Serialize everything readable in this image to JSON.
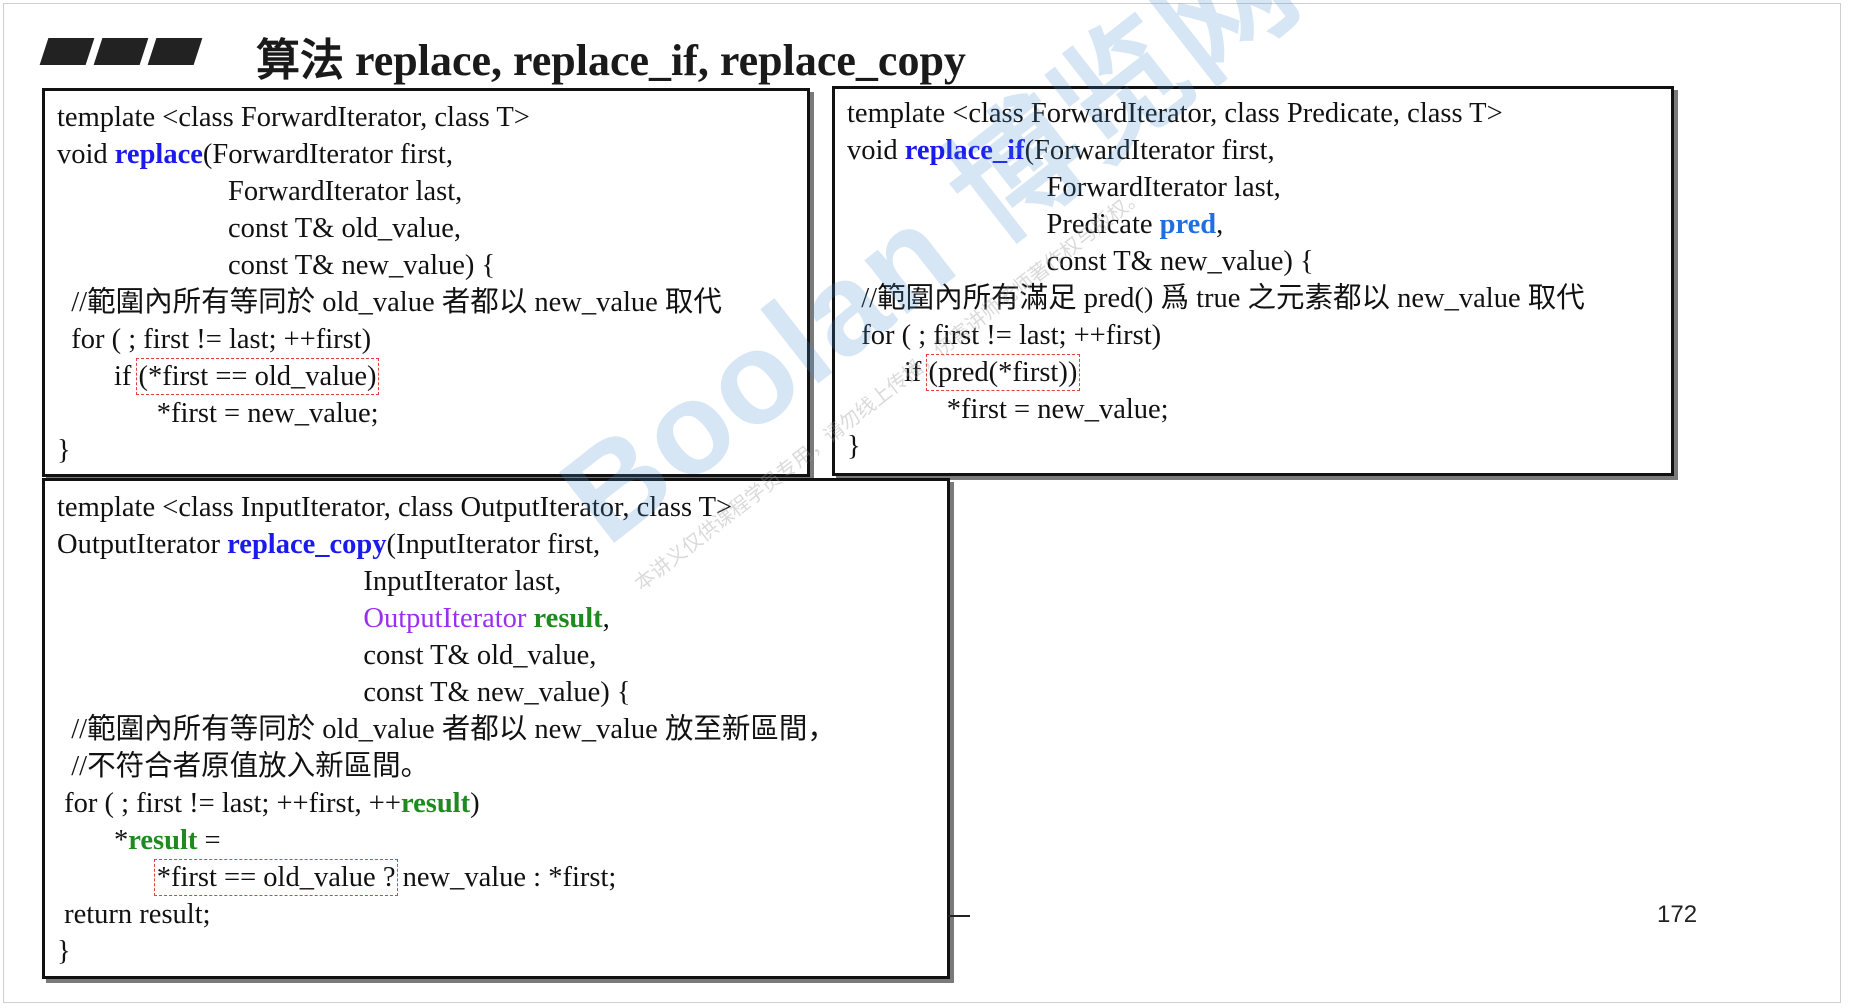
{
  "slide": {
    "title": "算法 replace, replace_if, replace_copy",
    "page_number": "172",
    "watermark_logo": "Boolan 博览网",
    "watermark_text": "本讲义仅供课程学员专用，请勿线上传播，伤害讲师老师著作权与版权。"
  },
  "boxes": {
    "replace": [
      [
        {
          "t": "template <class ForwardIterator, class T>"
        }
      ],
      [
        {
          "t": "void "
        },
        {
          "t": "replace",
          "c": "kw-blue"
        },
        {
          "t": "(ForwardIterator first,"
        }
      ],
      [
        {
          "t": "                        ForwardIterator last,"
        }
      ],
      [
        {
          "t": "                        const T& old_value,"
        }
      ],
      [
        {
          "t": "                        const T& new_value) {"
        }
      ],
      [
        {
          "t": "  //範圍內所有等同於 old_value 者都以 new_value 取代"
        }
      ],
      [
        {
          "t": "  for ( ; first != last; ++first)"
        }
      ],
      [
        {
          "t": "        if "
        },
        {
          "t": "(*first == old_value)",
          "c": "hl"
        }
      ],
      [
        {
          "t": "              *first = new_value;"
        }
      ],
      [
        {
          "t": "}"
        }
      ]
    ],
    "replace_if": [
      [
        {
          "t": "template <class ForwardIterator, class Predicate, class T>"
        }
      ],
      [
        {
          "t": "void "
        },
        {
          "t": "replace_if",
          "c": "kw-blue"
        },
        {
          "t": "(ForwardIterator first,"
        }
      ],
      [
        {
          "t": "                            ForwardIterator last,"
        }
      ],
      [
        {
          "t": "                            Predicate "
        },
        {
          "t": "pred",
          "c": "kw-blue2"
        },
        {
          "t": ","
        }
      ],
      [
        {
          "t": "                            const T& new_value) {"
        }
      ],
      [
        {
          "t": "  //範圍內所有滿足 pred() 爲 true 之元素都以 new_value 取代"
        }
      ],
      [
        {
          "t": "  for ( ; first != last; ++first)"
        }
      ],
      [
        {
          "t": "        if "
        },
        {
          "t": "(pred(*first))",
          "c": "hl"
        }
      ],
      [
        {
          "t": "              *first = new_value;"
        }
      ],
      [
        {
          "t": "}"
        }
      ]
    ],
    "replace_copy": [
      [
        {
          "t": "template <class InputIterator, class OutputIterator, class T>"
        }
      ],
      [
        {
          "t": "OutputIterator "
        },
        {
          "t": "replace_copy",
          "c": "kw-blue"
        },
        {
          "t": "(InputIterator first,"
        }
      ],
      [
        {
          "t": "                                           InputIterator last,"
        }
      ],
      [
        {
          "t": "                                           "
        },
        {
          "t": "OutputIterator ",
          "c": "kw-purple"
        },
        {
          "t": "result",
          "c": "kw-green"
        },
        {
          "t": ","
        }
      ],
      [
        {
          "t": "                                           const T& old_value,"
        }
      ],
      [
        {
          "t": "                                           const T& new_value) {"
        }
      ],
      [
        {
          "t": "  //範圍內所有等同於 old_value 者都以 new_value 放至新區間，"
        }
      ],
      [
        {
          "t": "  //不符合者原值放入新區間。"
        }
      ],
      [
        {
          "t": " for ( ; first != last; ++first, ++"
        },
        {
          "t": "result",
          "c": "kw-green"
        },
        {
          "t": ")"
        }
      ],
      [
        {
          "t": "        *"
        },
        {
          "t": "result",
          "c": "kw-green"
        },
        {
          "t": " ="
        }
      ],
      [
        {
          "t": "              "
        },
        {
          "t": "*first == old_value ?",
          "c": "hl"
        },
        {
          "t": " new_value : *first;"
        }
      ],
      [
        {
          "t": " return result;"
        }
      ],
      [
        {
          "t": "}"
        }
      ]
    ]
  }
}
